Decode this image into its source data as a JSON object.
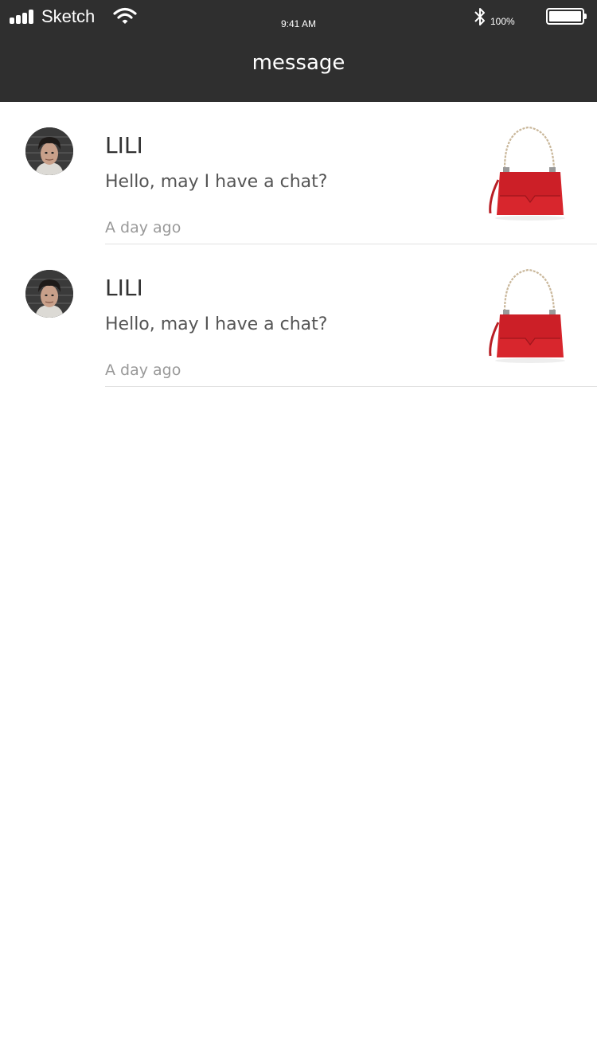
{
  "status_bar": {
    "carrier": "Sketch",
    "time": "9:41 AM",
    "battery_percent": "100%",
    "signal_icon": "signal-bars-icon",
    "wifi_icon": "wifi-icon",
    "bluetooth_icon": "bluetooth-icon",
    "battery_icon": "battery-icon",
    "battery_level": 1.0
  },
  "nav": {
    "title": "message"
  },
  "messages": [
    {
      "name": "LILI",
      "preview": "Hello, may I have a chat?",
      "time": "A day ago",
      "avatar_icon": "user-avatar",
      "thumbnail_icon": "red-handbag-thumbnail"
    },
    {
      "name": "LILI",
      "preview": "Hello, may I have a chat?",
      "time": "A day ago",
      "avatar_icon": "user-avatar",
      "thumbnail_icon": "red-handbag-thumbnail"
    }
  ],
  "colors": {
    "header_bg": "#2f2f2f",
    "header_text": "#ffffff",
    "name_text": "#333333",
    "preview_text": "#555555",
    "time_text": "#999999",
    "divider": "#e2e2e2",
    "bag_red": "#d8262d"
  }
}
